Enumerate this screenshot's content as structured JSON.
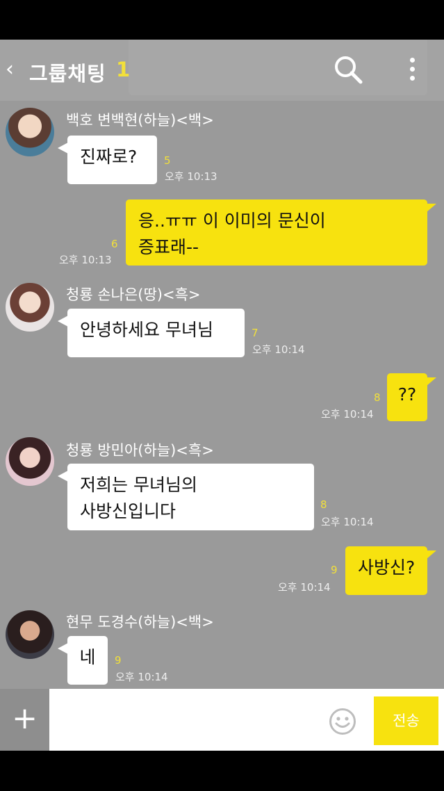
{
  "header": {
    "back_icon": "chevron-left-icon",
    "title": "그룹채팅",
    "member_count": "1",
    "search_icon": "search-icon",
    "menu_icon": "more-vertical-icon"
  },
  "colors": {
    "chat_background": "#9a9a9a",
    "outgoing_bubble": "#f7e20f",
    "incoming_bubble": "#ffffff",
    "unread_count": "#f2e03a"
  },
  "messages": [
    {
      "sender": "백호 변백현(하늘)<백>",
      "lines": [
        "진짜로?"
      ],
      "unread": "5",
      "time": "오후 10:13"
    },
    {
      "lines": [
        "응..ㅠㅠ 이 이미의 문신이",
        "증표래--"
      ],
      "unread": "6",
      "time": "오후 10:13"
    },
    {
      "sender": "청룡 손나은(땅)<흑>",
      "lines": [
        "안녕하세요 무녀님"
      ],
      "unread": "7",
      "time": "오후 10:14"
    },
    {
      "lines": [
        "??"
      ],
      "unread": "8",
      "time": "오후 10:14"
    },
    {
      "sender": "청룡 방민아(하늘)<흑>",
      "lines": [
        "저희는 무녀님의",
        "사방신입니다"
      ],
      "unread": "8",
      "time": "오후 10:14"
    },
    {
      "lines": [
        "사방신?"
      ],
      "unread": "9",
      "time": "오후 10:14"
    },
    {
      "sender": "현무 도경수(하늘)<백>",
      "lines": [
        "네"
      ],
      "unread": "9",
      "time": "오후 10:14"
    }
  ],
  "input": {
    "plus_label": "+",
    "emoji_icon": "smiley-icon",
    "send_label": "전송"
  }
}
